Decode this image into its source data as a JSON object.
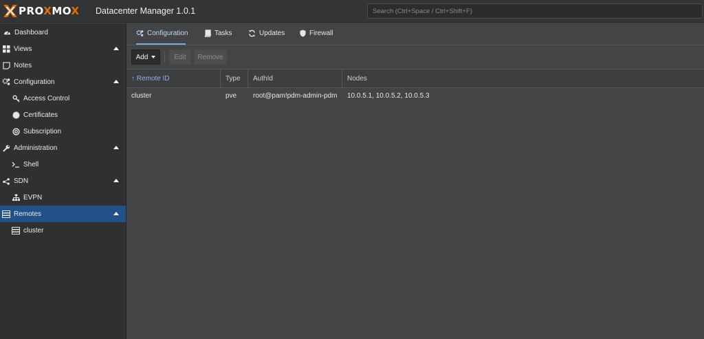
{
  "app": {
    "logo_text_prefix": "PRO",
    "logo_text_x": "X",
    "logo_text_mo": "MO",
    "logo_text_x2": "X",
    "title": "Datacenter Manager 1.0.1"
  },
  "search": {
    "placeholder": "Search (Ctrl+Space / Ctrl+Shift+F)"
  },
  "sidebar": {
    "items": [
      {
        "label": "Dashboard",
        "icon": "dashboard-icon"
      },
      {
        "label": "Views",
        "icon": "grid-icon"
      },
      {
        "label": "Notes",
        "icon": "note-icon"
      },
      {
        "label": "Configuration",
        "icon": "gears-icon"
      },
      {
        "label": "Access Control",
        "icon": "key-icon"
      },
      {
        "label": "Certificates",
        "icon": "certificate-icon"
      },
      {
        "label": "Subscription",
        "icon": "support-icon"
      },
      {
        "label": "Administration",
        "icon": "wrench-icon"
      },
      {
        "label": "Shell",
        "icon": "terminal-icon"
      },
      {
        "label": "SDN",
        "icon": "network-icon"
      },
      {
        "label": "EVPN",
        "icon": "sitemap-icon"
      },
      {
        "label": "Remotes",
        "icon": "server-icon"
      },
      {
        "label": "cluster",
        "icon": "server-icon"
      }
    ]
  },
  "tabs": [
    {
      "label": "Configuration",
      "icon": "gears-icon"
    },
    {
      "label": "Tasks",
      "icon": "book-icon"
    },
    {
      "label": "Updates",
      "icon": "refresh-icon"
    },
    {
      "label": "Firewall",
      "icon": "shield-icon"
    }
  ],
  "toolbar": {
    "add_label": "Add",
    "edit_label": "Edit",
    "remove_label": "Remove"
  },
  "grid": {
    "columns": [
      "Remote ID",
      "Type",
      "AuthId",
      "Nodes"
    ],
    "sort_indicator": "↑",
    "rows": [
      {
        "remote_id": "cluster",
        "type": "pve",
        "auth_id": "root@pam!pdm-admin-pdm",
        "nodes": "10.0.5.1, 10.0.5.2, 10.0.5.3"
      }
    ]
  },
  "colors": {
    "accent": "#e57000",
    "selected": "#225088",
    "active_tab": "#7fa6dd"
  }
}
